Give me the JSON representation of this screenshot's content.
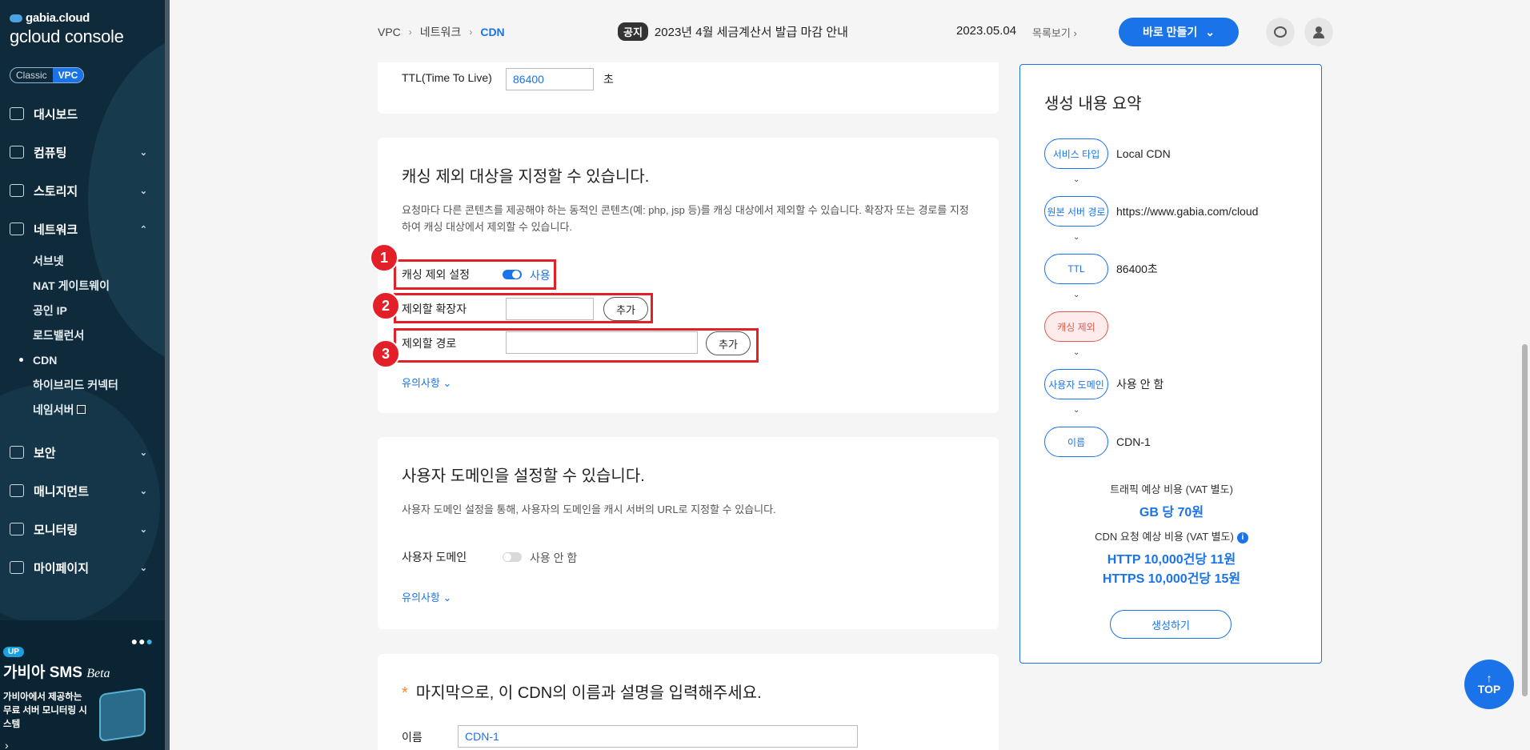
{
  "sidebar": {
    "brand_top": "gabia.cloud",
    "brand_main": "gcloud console",
    "env": {
      "classic": "Classic",
      "vpc": "VPC"
    },
    "items": [
      {
        "label": "대시보드"
      },
      {
        "label": "컴퓨팅"
      },
      {
        "label": "스토리지"
      },
      {
        "label": "네트워크"
      }
    ],
    "network_sub": [
      "서브넷",
      "NAT 게이트웨이",
      "공인 IP",
      "로드밸런서",
      "CDN",
      "하이브리드 커넥터",
      "네임서버"
    ],
    "items_bottom": [
      {
        "label": "보안"
      },
      {
        "label": "매니지먼트"
      },
      {
        "label": "모니터링"
      },
      {
        "label": "마이페이지"
      }
    ],
    "promo": {
      "badge": "UP",
      "title": "가비아 SMS",
      "title_suffix": "Beta",
      "desc": "가비아에서 제공하는 무료 서버 모니터링 시스템"
    }
  },
  "header": {
    "breadcrumb": [
      "VPC",
      "네트워크",
      "CDN"
    ],
    "notice_tag": "공지",
    "notice_text": "2023년 4월 세금계산서 발급 마감 안내",
    "date": "2023.05.04",
    "list_link": "목록보기",
    "make_button": "바로 만들기"
  },
  "ttl": {
    "label": "TTL(Time To Live)",
    "value": "86400",
    "unit": "초"
  },
  "cache_exclude": {
    "title": "캐싱 제외 대상을 지정할 수 있습니다.",
    "desc": "요청마다 다른 콘텐츠를 제공해야 하는 동적인 콘텐츠(예: php, jsp 등)를 캐싱 대상에서 제외할 수 있습니다. 확장자 또는 경로를 지정하여 캐싱 대상에서 제외할 수 있습니다.",
    "setting_label": "캐싱 제외 설정",
    "setting_state": "사용",
    "ext_label": "제외할 확장자",
    "ext_value": "",
    "path_label": "제외할 경로",
    "path_value": "",
    "add_button": "추가",
    "notes_link": "유의사항",
    "badges": [
      "1",
      "2",
      "3"
    ]
  },
  "user_domain": {
    "title": "사용자 도메인을 설정할 수 있습니다.",
    "desc": "사용자 도메인 설정을 통해, 사용자의 도메인을 캐시 서버의 URL로 지정할 수 있습니다.",
    "label": "사용자 도메인",
    "state": "사용 안 함",
    "notes_link": "유의사항"
  },
  "name_section": {
    "required_mark": "*",
    "title": "마지막으로, 이 CDN의 이름과 설명을 입력해주세요.",
    "name_label": "이름",
    "name_value": "CDN-1"
  },
  "summary": {
    "title": "생성 내용 요약",
    "steps": [
      {
        "pill": "서비스 타입",
        "value": "Local CDN"
      },
      {
        "pill": "원본 서버 경로",
        "value": "https://www.gabia.com/cloud"
      },
      {
        "pill": "TTL",
        "value": "86400초"
      },
      {
        "pill": "캐싱 제외",
        "value": ""
      },
      {
        "pill": "사용자 도메인",
        "value": "사용 안 함"
      },
      {
        "pill": "이름",
        "value": "CDN-1"
      }
    ],
    "traffic_label": "트래픽 예상 비용 (VAT 별도)",
    "traffic_value": "GB 당 70원",
    "request_label": "CDN 요청 예상 비용 (VAT 별도)",
    "request_http": "HTTP 10,000건당 11원",
    "request_https": "HTTPS 10,000건당 15원",
    "create_button": "생성하기"
  },
  "top_button": "TOP",
  "colors": {
    "accent": "#1a73e8",
    "highlight": "#e32028",
    "sidebar": "#0e2a3b"
  }
}
